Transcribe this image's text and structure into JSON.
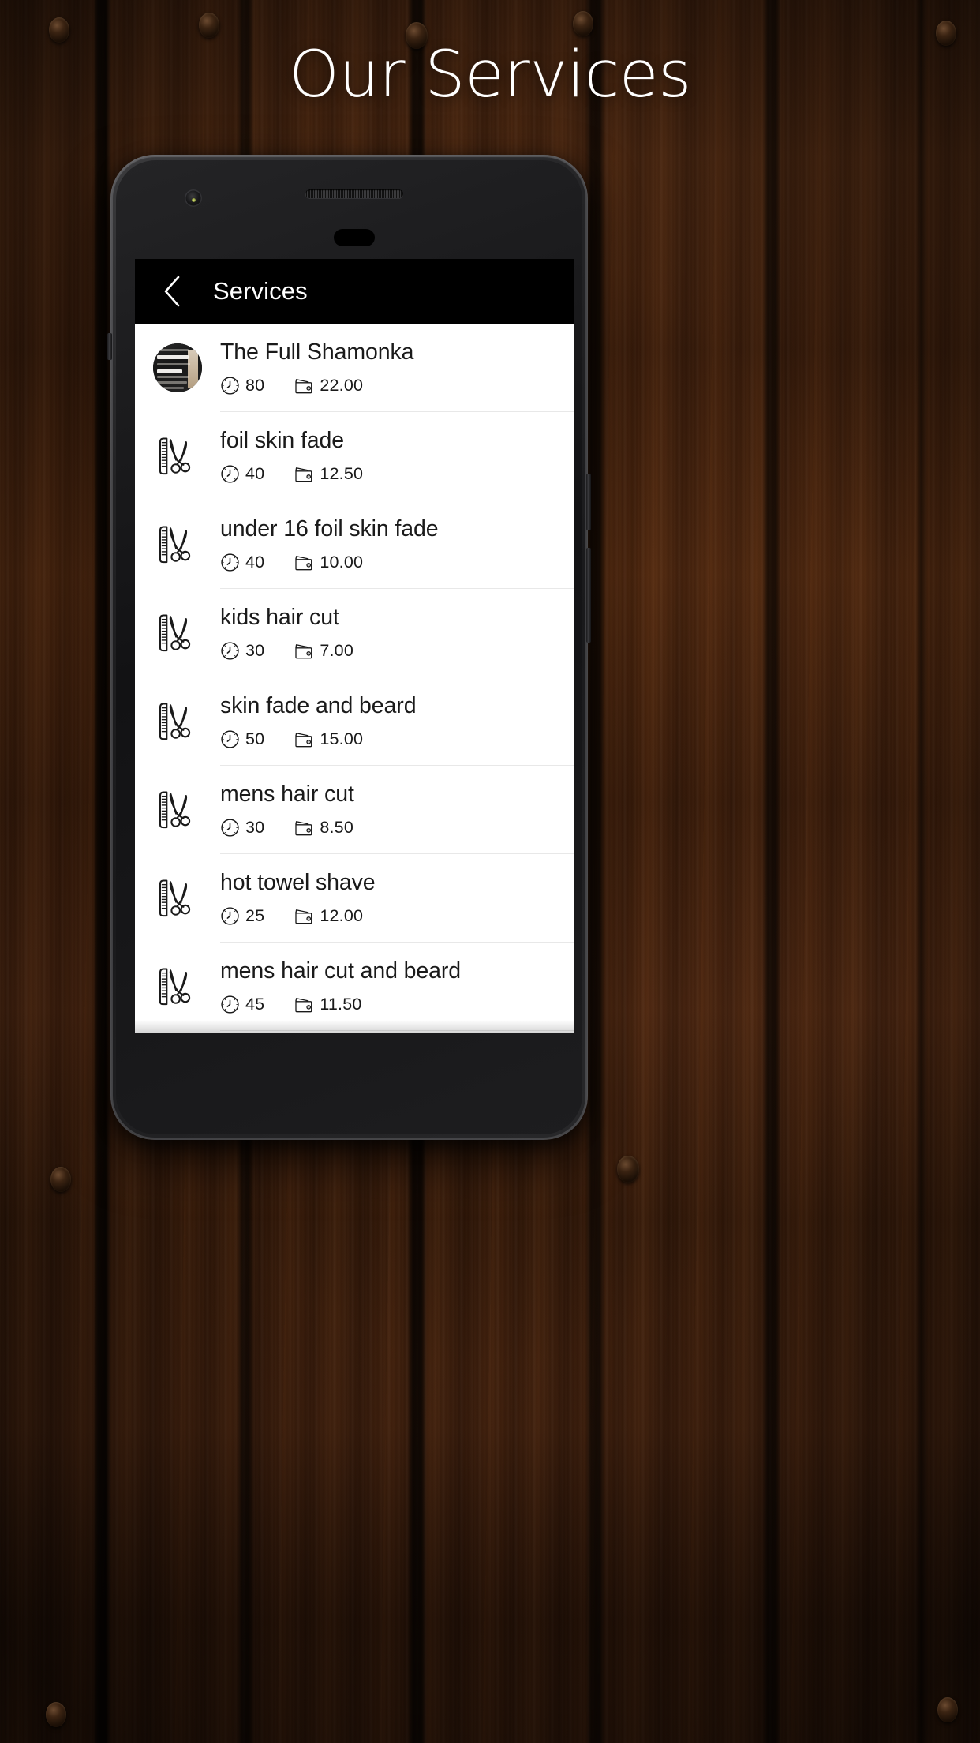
{
  "page": {
    "title": "Our Services",
    "background": "wood-planks-dark-brown"
  },
  "phone": {
    "device_chrome": {
      "front_camera": "front-camera",
      "earpiece": "earpiece-grille",
      "sensor": "sensor-pill"
    }
  },
  "app": {
    "app_bar": {
      "back_label": "‹",
      "title": "Services",
      "background": "#000000",
      "text_color": "#ffffff"
    },
    "icons": {
      "duration": "clock-icon",
      "price": "wallet-icon",
      "default_service": "comb-scissors-icon",
      "back": "chevron-left-icon"
    },
    "services": [
      {
        "name": "The Full Shamonka",
        "duration": "80",
        "price": "22.00",
        "thumb": "photo",
        "photo_lines": [
          "Nose wax",
          "Hot towel",
          "Eye brow shape"
        ]
      },
      {
        "name": "foil skin fade",
        "duration": "40",
        "price": "12.50",
        "thumb": "comb-scissors"
      },
      {
        "name": "under 16 foil skin fade",
        "duration": "40",
        "price": "10.00",
        "thumb": "comb-scissors"
      },
      {
        "name": "kids hair cut",
        "duration": "30",
        "price": "7.00",
        "thumb": "comb-scissors"
      },
      {
        "name": "skin fade and beard",
        "duration": "50",
        "price": "15.00",
        "thumb": "comb-scissors"
      },
      {
        "name": "mens hair cut",
        "duration": "30",
        "price": "8.50",
        "thumb": "comb-scissors"
      },
      {
        "name": "hot towel shave",
        "duration": "25",
        "price": "12.00",
        "thumb": "comb-scissors"
      },
      {
        "name": "mens hair cut and beard",
        "duration": "45",
        "price": "11.50",
        "thumb": "comb-scissors"
      }
    ]
  },
  "colors": {
    "accent": "#000000",
    "screen_bg": "#ffffff",
    "text_primary": "#1a1a1a",
    "divider": "#e8e8e8",
    "title_text": "#ffffff"
  }
}
